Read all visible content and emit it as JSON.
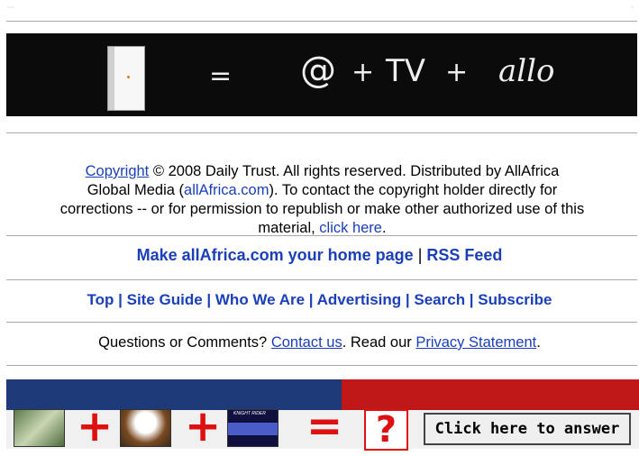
{
  "top_marks": {
    "left": "~~~",
    "right": "~"
  },
  "banner_top": {
    "equals": "=",
    "at": "@",
    "plus1": "+",
    "tv": "TV",
    "plus2": "+",
    "allo": "allo"
  },
  "copyright": {
    "link_label": "Copyright",
    "line1_rest": " © 2008 Daily Trust. All rights reserved. Distributed by AllAfrica",
    "line2_pre": "Global Media (",
    "site_link": "allAfrica.com",
    "line2_post": "). To contact the copyright holder directly for",
    "line3": "corrections -- or for permission to republish or make other authorized use of this",
    "line4_pre": "material, ",
    "click_here": "click here",
    "line4_post": "."
  },
  "home": {
    "make_home": "Make allAfrica.com your home page",
    "sep": " | ",
    "rss": "RSS Feed"
  },
  "nav": {
    "items": [
      "Top",
      "Site Guide",
      "Who We Are",
      "Advertising",
      "Search",
      "Subscribe"
    ],
    "sep": " | "
  },
  "contact": {
    "pre": "Questions or Comments? ",
    "contact_link": "Contact us",
    "mid": ". Read our ",
    "privacy_link": "Privacy Statement",
    "post": "."
  },
  "ad": {
    "plus": "+",
    "equals": "=",
    "question": "?",
    "tile_label": "KNIGHT RIDER",
    "button": "Click here to answer"
  }
}
